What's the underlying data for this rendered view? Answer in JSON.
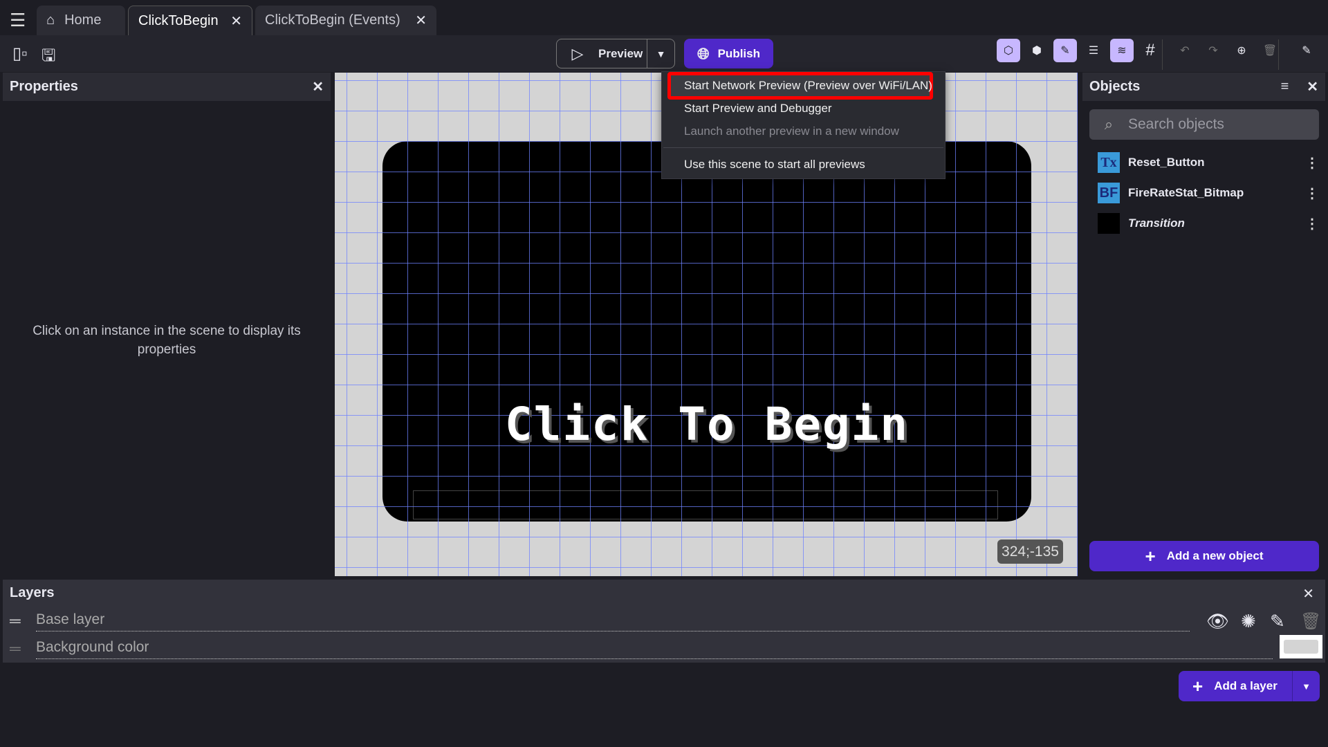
{
  "tabs": [
    {
      "label": "Home",
      "icon": "home-icon"
    },
    {
      "label": "ClickToBegin",
      "active": true
    },
    {
      "label": "ClickToBegin (Events)"
    }
  ],
  "toolbar": {
    "preview_label": "Preview",
    "publish_label": "Publish"
  },
  "preview_menu": {
    "items": [
      {
        "label": "Start Network Preview (Preview over WiFi/LAN)",
        "highlighted": true
      },
      {
        "label": "Start Preview and Debugger"
      },
      {
        "label": "Launch another preview in a new window",
        "disabled": true
      },
      {
        "label": "Use this scene to start all previews"
      }
    ]
  },
  "properties": {
    "title": "Properties",
    "empty_text": "Click on an instance in the scene to display its properties"
  },
  "scene": {
    "text": "Click To Begin",
    "coords": "324;-135",
    "background": "#d4d4d4"
  },
  "objects": {
    "title": "Objects",
    "search_placeholder": "Search objects",
    "items": [
      {
        "name": "Reset_Button",
        "thumb": "Tx"
      },
      {
        "name": "FireRateStat_Bitmap",
        "thumb": "BF"
      },
      {
        "name": "Transition",
        "italic": true
      }
    ],
    "add_label": "Add a new object"
  },
  "layers": {
    "title": "Layers",
    "items": [
      {
        "name": "Base layer"
      },
      {
        "name": "Background color"
      }
    ],
    "add_label": "Add a layer"
  },
  "colors": {
    "accent": "#4f28c9",
    "highlight_box": "#ff0000",
    "toggle_on": "#c7b7ff"
  }
}
